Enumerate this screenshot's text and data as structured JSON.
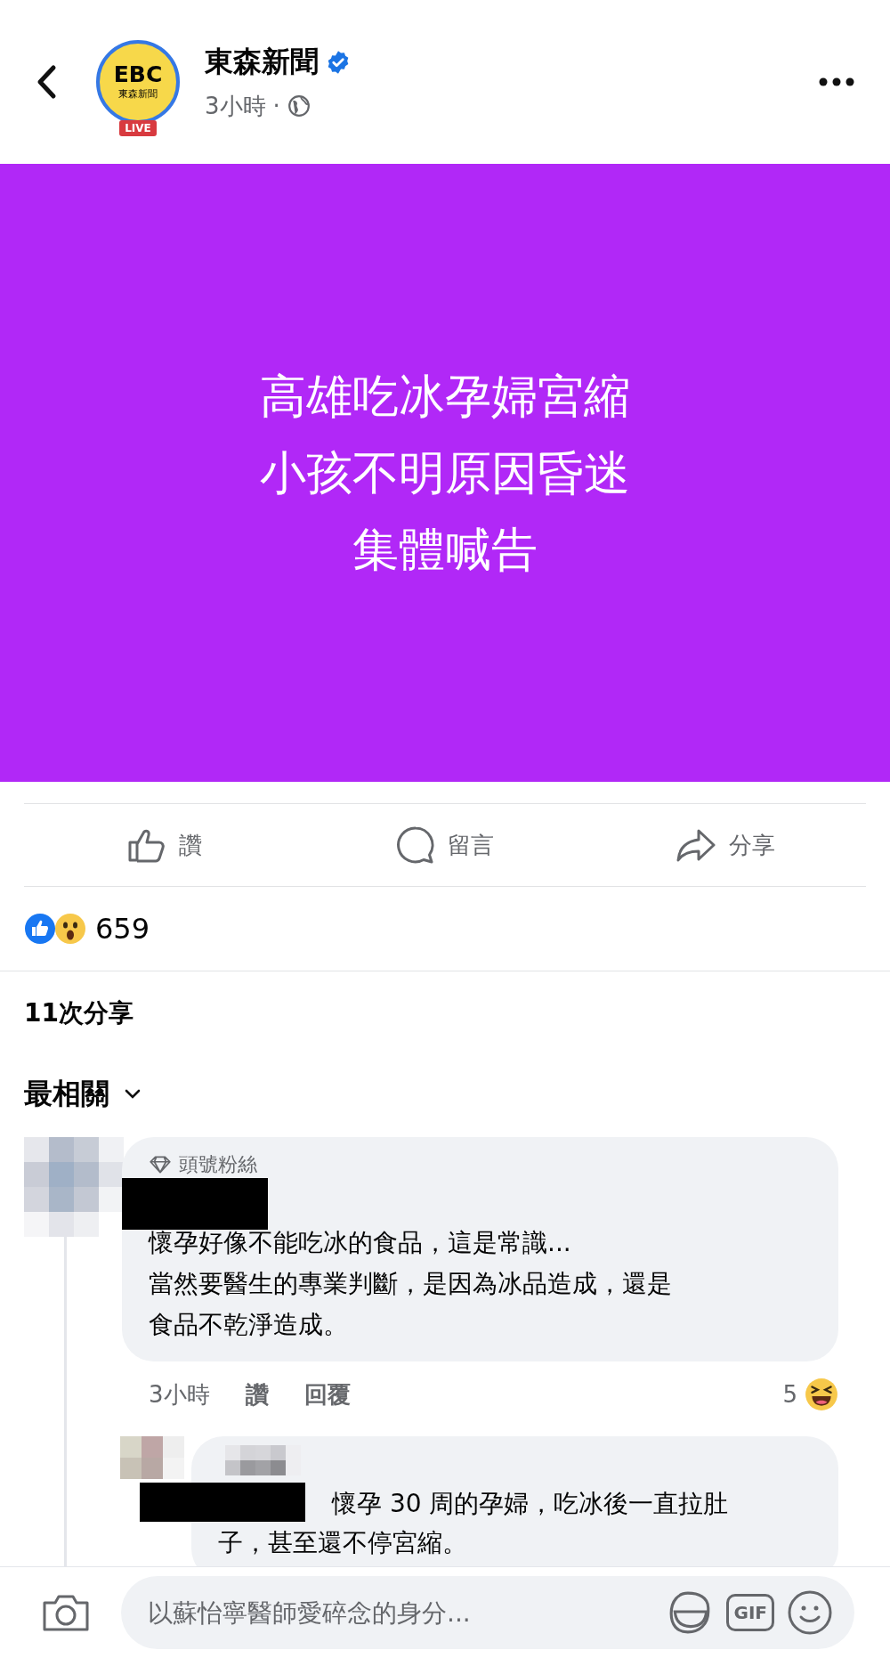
{
  "page": {
    "name": "東森新聞",
    "verified": true,
    "time": "3小時",
    "separator": "·",
    "avatar": {
      "logo": "EBC",
      "subtitle": "東森新聞",
      "badge": "LIVE"
    }
  },
  "post": {
    "lines": [
      "高雄吃冰孕婦宮縮",
      "小孩不明原因昏迷",
      "集體喊告"
    ]
  },
  "actions": [
    {
      "kind": "like",
      "label": "讚"
    },
    {
      "kind": "comment",
      "label": "留言"
    },
    {
      "kind": "share",
      "label": "分享"
    }
  ],
  "reactions": {
    "count": "659"
  },
  "shares": "11次分享",
  "sort": {
    "label": "最相關"
  },
  "comment": {
    "badge": "頭號粉絲",
    "lines": [
      "懷孕好像不能吃冰的食品，這是常識...",
      "當然要醫生的專業判斷，是因為冰品造成，還是",
      "食品不乾淨造成。"
    ],
    "time": "3小時",
    "like": "讚",
    "reply": "回覆",
    "reaction_count": "5"
  },
  "reply": {
    "lines": [
      "懷孕 30 周的孕婦，吃冰後一直拉肚",
      "子，甚至還不停宮縮。"
    ]
  },
  "composer": {
    "placeholder": "以蘇怡寧醫師愛碎念的身分...",
    "gif": "GIF"
  }
}
